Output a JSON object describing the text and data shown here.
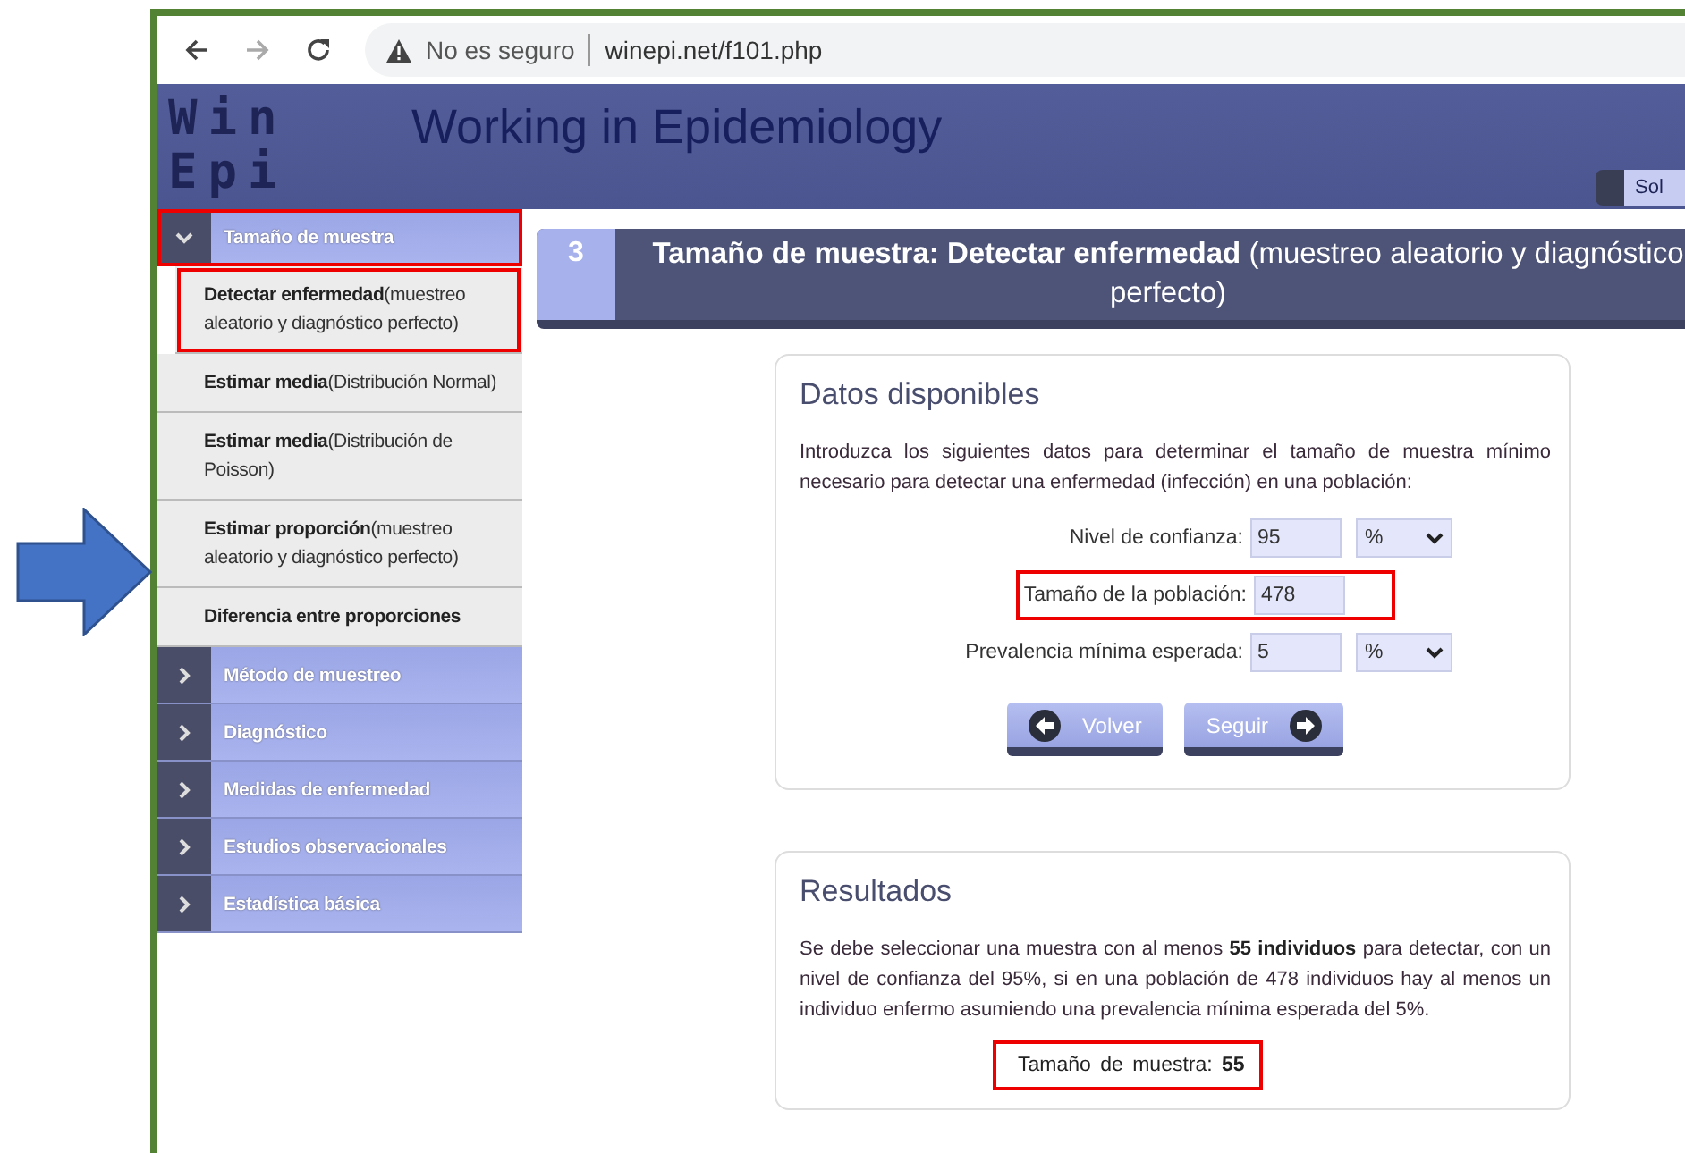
{
  "annotation_arrow": true,
  "browser": {
    "security": "No es seguro",
    "url": "winepi.net/f101.php"
  },
  "header": {
    "logo_top": "Win",
    "logo_bottom": "Epi",
    "title": "Working in Epidemiology",
    "button": "Sol"
  },
  "sidebar": {
    "sections": [
      {
        "label": "Tamaño de muestra",
        "expanded": true,
        "highlighted": true,
        "children": [
          {
            "title": "Detectar enfermedad",
            "detail": "(muestreo aleatorio y diagnóstico perfecto)",
            "highlighted": true
          },
          {
            "title": "Estimar media",
            "detail": "(Distribución Normal)",
            "highlighted": false
          },
          {
            "title": "Estimar media",
            "detail": "(Distribución de Poisson)",
            "highlighted": false
          },
          {
            "title": "Estimar proporción",
            "detail": "(muestreo aleatorio y diagnóstico perfecto)",
            "highlighted": false
          },
          {
            "title": "Diferencia entre proporciones",
            "highlighted": false
          }
        ]
      },
      {
        "label": "Método de muestreo",
        "expanded": false,
        "highlighted": false
      },
      {
        "label": "Diagnóstico",
        "expanded": false,
        "highlighted": false
      },
      {
        "label": "Medidas de enfermedad",
        "expanded": false,
        "highlighted": false
      },
      {
        "label": "Estudios observacionales",
        "expanded": false,
        "highlighted": false
      },
      {
        "label": "Estadística básica",
        "expanded": false,
        "highlighted": false
      }
    ]
  },
  "heading": {
    "number": "3",
    "title": "Tamaño de muestra: Detectar enfermedad",
    "detail": "(muestreo aleatorio y diagnóstico perfecto)"
  },
  "data_card": {
    "title": "Datos disponibles",
    "intro": "Introduzca los siguientes datos para determinar el tamaño de muestra mínimo necesario para detectar una enfermedad (infección) en una población:",
    "fields": [
      {
        "label": "Nivel de confianza:",
        "value": "95",
        "unit": "%"
      },
      {
        "label": "Tamaño de la población:",
        "value": "478",
        "highlighted": true
      },
      {
        "label": "Prevalencia mínima esperada:",
        "value": "5",
        "unit": "%"
      }
    ],
    "buttons": [
      {
        "label": "Volver",
        "kind": "back"
      },
      {
        "label": "Seguir",
        "kind": "next"
      }
    ]
  },
  "results_card": {
    "title": "Resultados",
    "text": "Se debe seleccionar una muestra con al menos **55 individuos** para detectar, con un nivel de confianza del 95%, si en una población de 478 individuos hay al menos un individuo enfermo asumiendo una prevalencia mínima esperada del 5%.",
    "result": {
      "label": "Tamaño de muestra:",
      "value": "55",
      "highlighted": true
    }
  }
}
